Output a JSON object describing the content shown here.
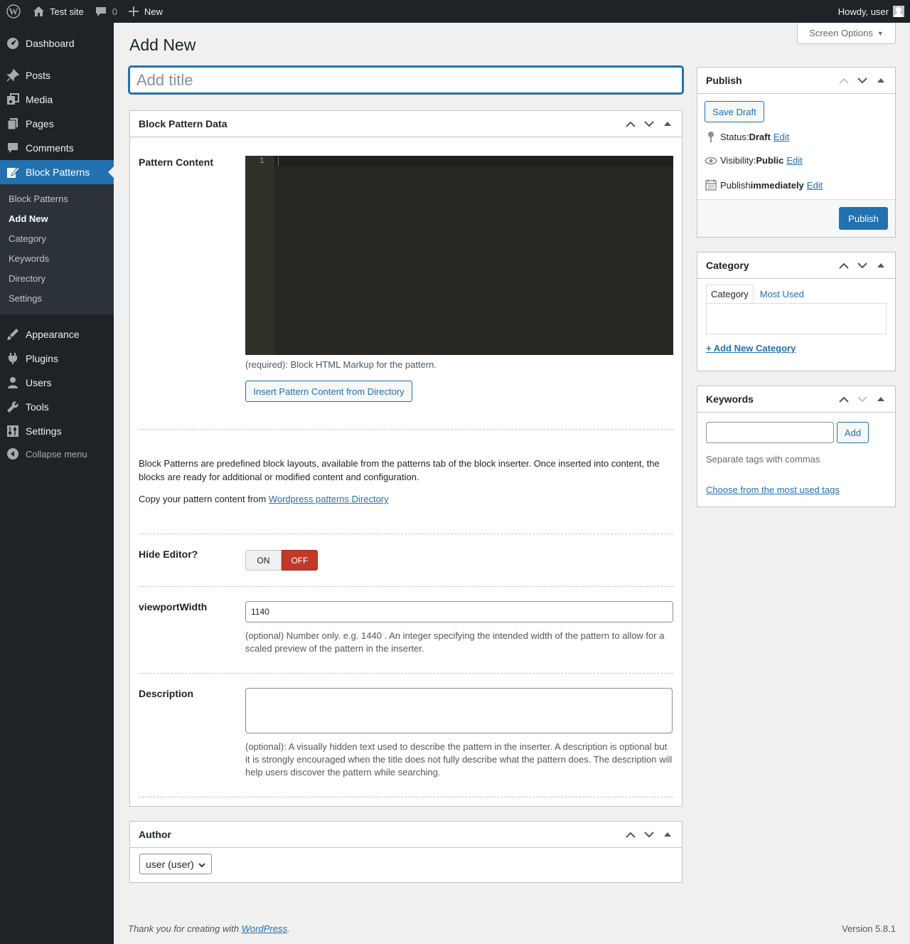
{
  "adminbar": {
    "site_name": "Test site",
    "comments_count": "0",
    "new_label": "New",
    "greeting": "Howdy, user"
  },
  "sidebar": {
    "items_top": [
      {
        "label": "Dashboard",
        "icon": "dashboard-icon"
      },
      {
        "label": "Posts",
        "icon": "pin-icon"
      },
      {
        "label": "Media",
        "icon": "media-icon"
      },
      {
        "label": "Pages",
        "icon": "pages-icon"
      },
      {
        "label": "Comments",
        "icon": "comment-icon"
      },
      {
        "label": "Block Patterns",
        "icon": "edit-page-icon"
      }
    ],
    "submenu": [
      "Block Patterns",
      "Add New",
      "Category",
      "Keywords",
      "Directory",
      "Settings"
    ],
    "items_bottom": [
      {
        "label": "Appearance",
        "icon": "brush-icon"
      },
      {
        "label": "Plugins",
        "icon": "plugin-icon"
      },
      {
        "label": "Users",
        "icon": "user-icon"
      },
      {
        "label": "Tools",
        "icon": "wrench-icon"
      },
      {
        "label": "Settings",
        "icon": "settings-icon"
      }
    ],
    "collapse_label": "Collapse menu"
  },
  "screen_options_label": "Screen Options",
  "page_title": "Add New",
  "title_placeholder": "Add title",
  "pattern_box": {
    "heading": "Block Pattern Data",
    "content_label": "Pattern Content",
    "line_number": "1",
    "content_help": "(required): Block HTML Markup for the pattern.",
    "insert_button": "Insert Pattern Content from Directory",
    "intro_text": "Block Patterns are predefined block layouts, available from the patterns tab of the block inserter. Once inserted into content, the blocks are ready for additional or modified content and configuration.",
    "copy_text": "Copy your pattern content from ",
    "directory_link": "Wordpress patterns Directory",
    "hide_editor_label": "Hide Editor?",
    "toggle_on": "ON",
    "toggle_off": "OFF",
    "viewport_label": "viewportWidth",
    "viewport_value": "1140",
    "viewport_help": "(optional) Number only. e.g. 1440 . An integer specifying the intended width of the pattern to allow for a scaled preview of the pattern in the inserter.",
    "description_label": "Description",
    "description_help": "(optional): A visually hidden text used to describe the pattern in the inserter. A description is optional but it is strongly encouraged when the title does not fully describe what the pattern does. The description will help users discover the pattern while searching."
  },
  "author_box": {
    "heading": "Author",
    "selected": "user (user)"
  },
  "publish_box": {
    "heading": "Publish",
    "save_draft": "Save Draft",
    "status_label": "Status: ",
    "status_value": "Draft",
    "visibility_label": "Visibility: ",
    "visibility_value": "Public",
    "publish_label": "Publish ",
    "publish_value": "immediately",
    "edit_link": "Edit",
    "publish_button": "Publish"
  },
  "category_box": {
    "heading": "Category",
    "tab_all": "Category",
    "tab_most_used": "Most Used",
    "add_new": "+ Add New Category"
  },
  "keywords_box": {
    "heading": "Keywords",
    "add_button": "Add",
    "help": "Separate tags with commas",
    "choose_link": "Choose from the most used tags"
  },
  "footer": {
    "thanks": "Thank you for creating with ",
    "wp_link": "WordPress",
    "period": ".",
    "version": "Version 5.8.1"
  },
  "colors": {
    "admin_dark": "#1d2327",
    "accent_blue": "#2271b1",
    "toggle_off_red": "#c0392b"
  }
}
